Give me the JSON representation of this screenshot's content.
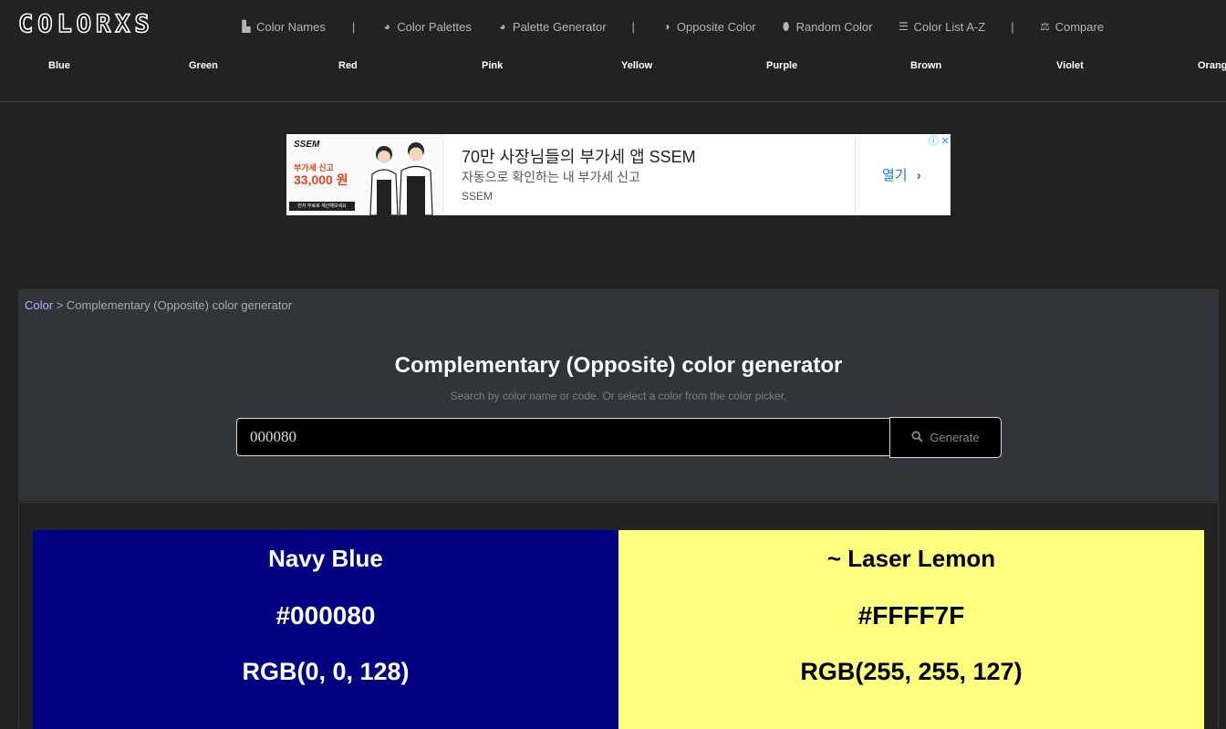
{
  "site": {
    "logo": "COLORXS"
  },
  "nav": [
    {
      "label": "Color Names",
      "icon": "color-names-icon",
      "glyph": "▙"
    },
    {
      "label": "Color Palettes",
      "icon": "palette-icon",
      "glyph": "◕"
    },
    {
      "label": "Palette Generator",
      "icon": "palette-icon",
      "glyph": "◕"
    },
    {
      "label": "Opposite Color",
      "icon": "yin-yang-icon",
      "glyph": "◑"
    },
    {
      "label": "Random Color",
      "icon": "drop-icon",
      "glyph": "⬮"
    },
    {
      "label": "Color List A-Z",
      "icon": "list-icon",
      "glyph": "☰"
    },
    {
      "label": "Compare",
      "icon": "scale-icon",
      "glyph": "⚖"
    }
  ],
  "nav_separator": "|",
  "color_links": [
    "Blue",
    "Green",
    "Red",
    "Pink",
    "Yellow",
    "Purple",
    "Brown",
    "Violet",
    "Orange"
  ],
  "ad": {
    "brand": "SSEM",
    "sub": "부가세 신고",
    "price": "33,000 원",
    "tiny": "먼저 무료로 계산해보세요",
    "title": "70만 사장님들의 부가세 앱 SSEM",
    "description": "자동으로 확인하는 내 부가세 신고",
    "source": "SSEM",
    "cta": "열기"
  },
  "breadcrumb": {
    "root": "Color",
    "separator": ">",
    "current": "Complementary (Opposite) color generator"
  },
  "tool": {
    "title": "Complementary (Opposite) color generator",
    "subtitle": "Search by color name or code. Or select a color from the color picker.",
    "input_value": "000080",
    "button_label": "Generate"
  },
  "result": {
    "original": {
      "name": "Navy Blue",
      "hex": "#000080",
      "rgb": "RGB(0, 0, 128)",
      "bg": "#000080",
      "fg": "#ffffff"
    },
    "opposite": {
      "name": "~ Laser Lemon",
      "hex": "#FFFF7F",
      "rgb": "RGB(255, 255, 127)",
      "bg": "#FFFF7F",
      "fg": "#000000"
    }
  }
}
